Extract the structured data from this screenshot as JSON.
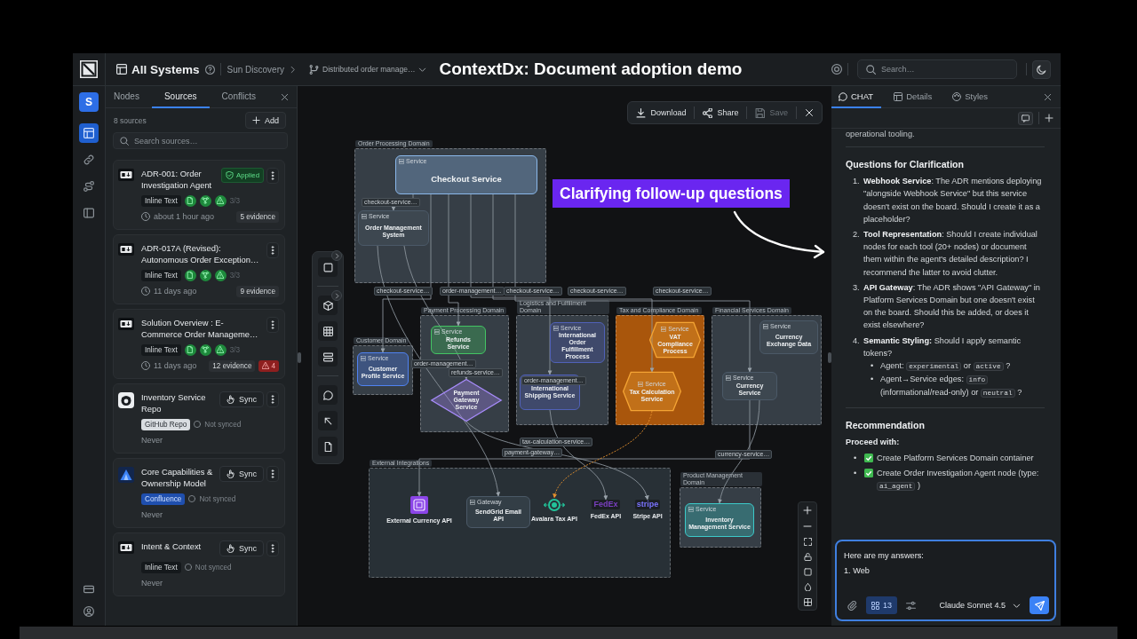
{
  "header": {
    "workspace": "All Systems",
    "breadcrumb": "Sun Discovery",
    "branch": "Distributed order manage…",
    "title": "ContextDx: Document adoption demo",
    "search": {
      "placeholder": "Search…"
    }
  },
  "rail": {
    "avatar": "S",
    "items": [
      {
        "kind": "layout",
        "selected": true
      },
      {
        "kind": "link",
        "selected": false
      },
      {
        "kind": "route",
        "selected": false
      },
      {
        "kind": "panel",
        "selected": false
      }
    ]
  },
  "left_panel": {
    "tabs": [
      {
        "label": "Nodes",
        "selected": false
      },
      {
        "label": "Sources",
        "selected": true
      },
      {
        "label": "Conflicts",
        "selected": false
      }
    ],
    "count": "8 sources",
    "add_button": "Add",
    "search": {
      "placeholder": "Search sources…"
    },
    "sources": [
      {
        "kind": "inline",
        "title": "ADR-001: Order Investigation Agent",
        "status": "Applied",
        "tag": "Inline Text",
        "checks": [
          {
            "kind": "document",
            "done": true
          },
          {
            "kind": "network",
            "done": true
          },
          {
            "kind": "warning",
            "done": true
          }
        ],
        "check_count": "3/3",
        "time": "about 1 hour ago",
        "evidence": "5 evidence"
      },
      {
        "kind": "inline",
        "title": "ADR-017A (Revised): Autonomous Order Exception…",
        "tag": "Inline Text",
        "checks": [
          {
            "kind": "document",
            "done": true
          },
          {
            "kind": "network",
            "done": true
          },
          {
            "kind": "warning",
            "done": true
          }
        ],
        "check_count": "3/3",
        "time": "11 days ago",
        "evidence": "9 evidence"
      },
      {
        "kind": "inline",
        "title": "Solution Overview : E-Commerce Order Manageme…",
        "tag": "Inline Text",
        "checks": [
          {
            "kind": "document",
            "done": true
          },
          {
            "kind": "network",
            "done": true
          },
          {
            "kind": "warning",
            "done": true
          }
        ],
        "check_count": "3/3",
        "time": "11 days ago",
        "evidence": "12 evidence",
        "warnings": "4"
      },
      {
        "kind": "github",
        "title": "Inventory Service Repo",
        "sync_button": "Sync",
        "tag": "GitHub Repo",
        "sync_status": "Not synced",
        "time": "Never"
      },
      {
        "kind": "confluence",
        "title": "Core Capabilities & Ownership Model",
        "sync_button": "Sync",
        "tag": "Confluence",
        "sync_status": "Not synced",
        "time": "Never"
      },
      {
        "kind": "inline",
        "title": "Intent & Context",
        "sync_button": "Sync",
        "tag": "Inline Text",
        "sync_status": "Not synced",
        "time": "Never"
      }
    ]
  },
  "canvas": {
    "toolbar": [
      {
        "kind": "download",
        "label": "Download",
        "disabled": false
      },
      {
        "kind": "share",
        "label": "Share",
        "disabled": false
      },
      {
        "kind": "save",
        "label": "Save",
        "disabled": true
      }
    ],
    "callout": "Clarifying follow-up questions",
    "groups": [
      {
        "label": "Order Processing Domain",
        "color": "#363e46"
      },
      {
        "label": "Customer Domain",
        "color": "#363e46"
      },
      {
        "label": "Payment Processing Domain",
        "color": "#363e46"
      },
      {
        "label": "Logistics and Fulfillment Domain",
        "color": "#363e46"
      },
      {
        "label": "Tax and Compliance Domain",
        "color": "#a9560c"
      },
      {
        "label": "Financial Services Domain",
        "color": "#363e46"
      },
      {
        "label": "External Integrations",
        "color": "#283036"
      },
      {
        "label": "Product Management Domain",
        "color": "#363e46"
      }
    ],
    "nodes": [
      {
        "kind": "rounded",
        "type": "Service",
        "name": "Checkout Service",
        "color": "#8ab8ea"
      },
      {
        "kind": "rounded",
        "type": "Service",
        "name": "Order Management System",
        "color": "#4b5967"
      },
      {
        "kind": "rounded",
        "type": "Service",
        "name": "Customer Profile Service",
        "color": "#4f82f2"
      },
      {
        "kind": "rounded",
        "type": "Service",
        "name": "Refunds Service",
        "color": "#43c463"
      },
      {
        "kind": "diamond",
        "name": "Payment Gateway Service",
        "color": "#a78bfa"
      },
      {
        "kind": "rounded",
        "type": "Service",
        "name": "International Order Fulfillment Process",
        "color": "#5061b8"
      },
      {
        "kind": "rounded",
        "name": "International Shipping Service",
        "color": "#5061b8"
      },
      {
        "kind": "hexagon",
        "type": "Service",
        "name": "VAT Compliance Process",
        "color": "#f4a434"
      },
      {
        "kind": "hexagon",
        "type": "Service",
        "name": "Tax Calculation Service",
        "color": "#f4a434"
      },
      {
        "kind": "rounded",
        "type": "Service",
        "name": "Currency Exchange Data",
        "color": "#4b5967"
      },
      {
        "kind": "rounded",
        "type": "Service",
        "name": "Currency Service",
        "color": "#4b5967"
      },
      {
        "kind": "tile",
        "name": "External Currency API",
        "color": "#8b45e8"
      },
      {
        "kind": "rounded",
        "type": "Gateway",
        "name": "SendGrid Email API",
        "color": "#4b5967"
      },
      {
        "kind": "disc",
        "name": "Avalara Tax API",
        "color": "#22c39a"
      },
      {
        "kind": "wordmark",
        "logo_text": "FedEx",
        "name": "FedEx API",
        "color": "#7a3fc0"
      },
      {
        "kind": "wordmark",
        "logo_text": "stripe",
        "name": "Stripe API",
        "color": "#7a73ff"
      },
      {
        "kind": "rounded",
        "type": "Service",
        "name": "Inventory Management Service",
        "color": "#3cc9c9"
      }
    ],
    "edge_labels": [
      "checkout-service…",
      "checkout-service…",
      "order-management…",
      "checkout-service…",
      "checkout-service…",
      "checkout-service…",
      "order-management…",
      "refunds-service…",
      "order-management…",
      "payment-gateway…",
      "tax-calculation-service…",
      "currency-service…"
    ]
  },
  "chat": {
    "tabs": [
      {
        "kind": "chat",
        "label": "CHAT",
        "selected": true
      },
      {
        "kind": "details",
        "label": "Details",
        "selected": false
      },
      {
        "kind": "styles",
        "label": "Styles",
        "selected": false
      }
    ],
    "lead": "operational tooling.",
    "sections": [
      {
        "heading": "Questions for Clarification",
        "items": [
          {
            "number": "1.",
            "text": "**Webhook Service**: The ADR mentions deploying \"alongside Webhook Service\" but this service doesn't exist on the board. Should I create it as a placeholder?"
          },
          {
            "number": "2.",
            "text": "**Tool Representation**: Should I create individual nodes for each tool (20+ nodes) or document them within the agent's detailed description? I recommend the latter to avoid clutter."
          },
          {
            "number": "3.",
            "text": "**API Gateway**: The ADR shows \"API Gateway\" in Platform Services Domain but one doesn't exist on the board. Should this be added, or does it exist elsewhere?"
          },
          {
            "number": "4.",
            "text": "**Semantic Styling:** Should I apply semantic tokens?",
            "bullets": [
              {
                "marker": "•",
                "parts": [
                  {
                    "kind": "text",
                    "text": "Agent: "
                  },
                  {
                    "kind": "code",
                    "text": "experimental"
                  },
                  {
                    "kind": "text",
                    "text": " or "
                  },
                  {
                    "kind": "code",
                    "text": "active"
                  },
                  {
                    "kind": "text",
                    "text": " ?"
                  }
                ]
              },
              {
                "marker": "•",
                "parts": [
                  {
                    "kind": "text",
                    "text": "Agent→Service edges: "
                  },
                  {
                    "kind": "code",
                    "text": "info"
                  },
                  {
                    "kind": "text",
                    "text": " (informational/read-only) or "
                  },
                  {
                    "kind": "code",
                    "text": "neutral"
                  },
                  {
                    "kind": "text",
                    "text": " ?"
                  }
                ]
              }
            ]
          }
        ]
      },
      {
        "heading": "Recommendation",
        "subheading": "Proceed with:",
        "checklist": [
          {
            "marker": "•",
            "checked": true,
            "parts": [
              {
                "kind": "text",
                "text": "Create Platform Services Domain container"
              }
            ]
          },
          {
            "marker": "•",
            "checked": true,
            "parts": [
              {
                "kind": "text",
                "text": "Create Order Investigation Agent node (type: "
              },
              {
                "kind": "code",
                "text": "ai_agent"
              },
              {
                "kind": "text",
                "text": " )"
              }
            ]
          }
        ]
      }
    ],
    "composer": {
      "value": "Here are my answers:\n1. Web",
      "context_count": "13",
      "model": "Claude Sonnet 4.5"
    }
  }
}
